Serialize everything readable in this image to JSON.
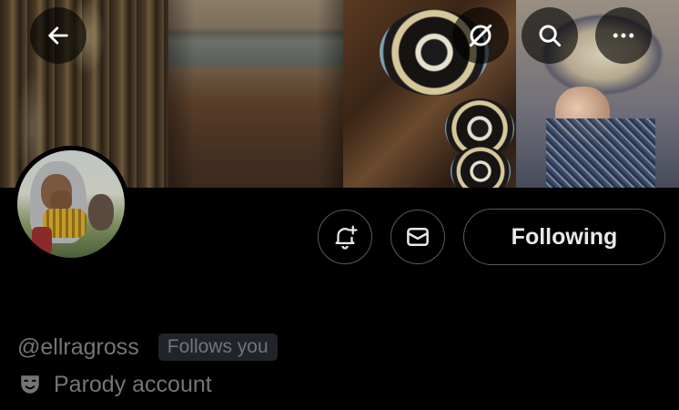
{
  "profile": {
    "handle": "@ellragross",
    "follows_you_badge": "Follows you",
    "parody_label": "Parody account"
  },
  "actions": {
    "following_label": "Following"
  },
  "icons": {
    "back": "arrow-left-icon",
    "translate": "translate-off-icon",
    "search": "search-icon",
    "more": "more-horizontal-icon",
    "notify": "bell-plus-icon",
    "message": "envelope-icon",
    "parody": "theater-mask-icon"
  },
  "colors": {
    "background": "#000000",
    "primary_text": "#e7e9ea",
    "secondary_text": "#71767b",
    "border": "#5a5a5a",
    "badge_bg": "#202327"
  }
}
